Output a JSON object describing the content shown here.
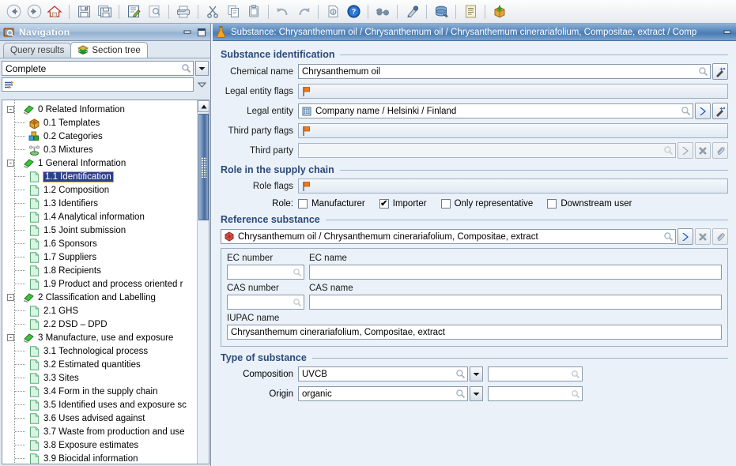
{
  "toolbar": {
    "buttons": [
      {
        "name": "back-button",
        "icon": "back-arrow-icon",
        "title": "Back"
      },
      {
        "name": "forward-button",
        "icon": "forward-arrow-icon",
        "title": "Forward"
      },
      {
        "name": "home-button",
        "icon": "home-icon",
        "title": "Home"
      },
      {
        "name": "save-button",
        "icon": "save-disk-icon",
        "title": "Save"
      },
      {
        "name": "save-all-button",
        "icon": "save-all-disk-icon",
        "title": "Save all"
      },
      {
        "name": "edit-button",
        "icon": "edit-pencil-icon",
        "title": "Edit"
      },
      {
        "name": "preview-button",
        "icon": "preview-page-icon",
        "title": "Preview"
      },
      {
        "name": "print-button",
        "icon": "printer-icon",
        "title": "Print"
      },
      {
        "name": "cut-button",
        "icon": "scissors-icon",
        "title": "Cut"
      },
      {
        "name": "copy-button",
        "icon": "copy-icon",
        "title": "Copy"
      },
      {
        "name": "paste-button",
        "icon": "paste-clipboard-icon",
        "title": "Paste"
      },
      {
        "name": "undo-button",
        "icon": "undo-arrow-icon",
        "title": "Undo"
      },
      {
        "name": "redo-button",
        "icon": "redo-arrow-icon",
        "title": "Redo"
      },
      {
        "name": "document-info-button",
        "icon": "document-info-icon",
        "title": "Document info"
      },
      {
        "name": "help-button",
        "icon": "help-question-icon",
        "title": "Help"
      },
      {
        "name": "view-button",
        "icon": "glasses-icon",
        "title": "View"
      },
      {
        "name": "annotation-button",
        "icon": "ink-pen-icon",
        "title": "Annotation"
      },
      {
        "name": "database-button",
        "icon": "database-stack-icon",
        "title": "Database"
      },
      {
        "name": "report-button",
        "icon": "report-list-icon",
        "title": "Report"
      },
      {
        "name": "package-button",
        "icon": "package-box-icon",
        "title": "Package"
      }
    ]
  },
  "navigation": {
    "title": "Navigation",
    "window_buttons": [
      {
        "name": "minimize-button",
        "icon": "minimize-icon"
      },
      {
        "name": "maximize-button",
        "icon": "maximize-icon"
      }
    ],
    "tabs": [
      {
        "label": "Query results",
        "active": false,
        "icon": null
      },
      {
        "label": "Section tree",
        "active": true,
        "icon": "layers-icon"
      }
    ],
    "filter": {
      "value": "Complete",
      "search_icon": "magnifier-icon",
      "dropdown_icon": "chevron-down-icon"
    },
    "filter2": {
      "value": "",
      "left_icon": "filter-arrows-icon",
      "dropdown_icon": "triangle-down-icon"
    },
    "tree": [
      {
        "label": "0 Related Information",
        "level": 0,
        "icon": "green-diamond-icon",
        "expander": "-",
        "selected": false
      },
      {
        "label": "0.1 Templates",
        "level": 1,
        "icon": "templates-box-icon",
        "expander": null,
        "selected": false
      },
      {
        "label": "0.2 Categories",
        "level": 1,
        "icon": "categories-icon",
        "expander": null,
        "selected": false
      },
      {
        "label": "0.3 Mixtures",
        "level": 1,
        "icon": "mixtures-icon",
        "expander": null,
        "selected": false
      },
      {
        "label": "1 General Information",
        "level": 0,
        "icon": "green-diamond-icon",
        "expander": "-",
        "selected": false
      },
      {
        "label": "1.1 Identification",
        "level": 1,
        "icon": "page-icon",
        "expander": null,
        "selected": true
      },
      {
        "label": "1.2 Composition",
        "level": 1,
        "icon": "page-icon",
        "expander": null,
        "selected": false
      },
      {
        "label": "1.3 Identifiers",
        "level": 1,
        "icon": "page-icon",
        "expander": null,
        "selected": false
      },
      {
        "label": "1.4 Analytical information",
        "level": 1,
        "icon": "page-icon",
        "expander": null,
        "selected": false
      },
      {
        "label": "1.5 Joint submission",
        "level": 1,
        "icon": "page-icon",
        "expander": null,
        "selected": false
      },
      {
        "label": "1.6 Sponsors",
        "level": 1,
        "icon": "page-icon",
        "expander": null,
        "selected": false
      },
      {
        "label": "1.7 Suppliers",
        "level": 1,
        "icon": "page-icon",
        "expander": null,
        "selected": false
      },
      {
        "label": "1.8 Recipients",
        "level": 1,
        "icon": "page-icon",
        "expander": null,
        "selected": false
      },
      {
        "label": "1.9 Product and process oriented r",
        "level": 1,
        "icon": "page-icon",
        "expander": null,
        "selected": false
      },
      {
        "label": "2 Classification and Labelling",
        "level": 0,
        "icon": "green-diamond-icon",
        "expander": "-",
        "selected": false
      },
      {
        "label": "2.1 GHS",
        "level": 1,
        "icon": "page-icon",
        "expander": null,
        "selected": false
      },
      {
        "label": "2.2 DSD – DPD",
        "level": 1,
        "icon": "page-icon",
        "expander": null,
        "selected": false
      },
      {
        "label": "3 Manufacture, use and exposure",
        "level": 0,
        "icon": "green-diamond-icon",
        "expander": "-",
        "selected": false
      },
      {
        "label": "3.1 Technological process",
        "level": 1,
        "icon": "page-icon",
        "expander": null,
        "selected": false
      },
      {
        "label": "3.2 Estimated quantities",
        "level": 1,
        "icon": "page-icon",
        "expander": null,
        "selected": false
      },
      {
        "label": "3.3 Sites",
        "level": 1,
        "icon": "page-icon",
        "expander": null,
        "selected": false
      },
      {
        "label": "3.4 Form in the supply chain",
        "level": 1,
        "icon": "page-icon",
        "expander": null,
        "selected": false
      },
      {
        "label": "3.5 Identified uses and exposure sc",
        "level": 1,
        "icon": "page-icon",
        "expander": null,
        "selected": false
      },
      {
        "label": "3.6 Uses advised against",
        "level": 1,
        "icon": "page-icon",
        "expander": null,
        "selected": false
      },
      {
        "label": "3.7 Waste from production and use",
        "level": 1,
        "icon": "page-icon",
        "expander": null,
        "selected": false
      },
      {
        "label": "3.8 Exposure estimates",
        "level": 1,
        "icon": "page-icon",
        "expander": null,
        "selected": false
      },
      {
        "label": "3.9 Biocidal information",
        "level": 1,
        "icon": "page-icon",
        "expander": null,
        "selected": false
      }
    ]
  },
  "main": {
    "title": "Substance: Chrysanthemum oil / Chrysanthemum oil / Chrysanthemum cinerariafolium, Compositae, extract / Comp",
    "title_icon": "flask-icon",
    "window_buttons": [
      {
        "name": "minimize-button",
        "icon": "minimize-icon"
      }
    ],
    "substance_identification": {
      "heading": "Substance identification",
      "chemical_name": {
        "label": "Chemical name",
        "value": "Chrysanthemum oil",
        "search_icon": "magnifier-icon",
        "action_icon": "wand-icon"
      },
      "legal_entity_flags": {
        "label": "Legal entity flags",
        "value": "",
        "flag_icon": "orange-flag-icon"
      },
      "legal_entity": {
        "label": "Legal entity",
        "value": "Company name / Helsinki / Finland",
        "entity_icon": "building-icon",
        "search_icon": "magnifier-icon",
        "go_icon": "blue-chevron-right-icon",
        "action_icon": "wand-icon"
      },
      "third_party_flags": {
        "label": "Third party flags",
        "value": "",
        "flag_icon": "orange-flag-icon"
      },
      "third_party": {
        "label": "Third party",
        "value": "",
        "search_icon": "magnifier-icon",
        "go_icon": "grey-chevron-right-icon",
        "clear_icon": "grey-x-icon",
        "attach_icon": "paperclip-icon"
      }
    },
    "role_supply_chain": {
      "heading": "Role in the supply chain",
      "role_flags": {
        "label": "Role flags",
        "value": "",
        "flag_icon": "orange-flag-icon"
      },
      "role_label": "Role:",
      "roles": [
        {
          "label": "Manufacturer",
          "checked": false
        },
        {
          "label": "Importer",
          "checked": true
        },
        {
          "label": "Only representative",
          "checked": false
        },
        {
          "label": "Downstream user",
          "checked": false
        }
      ]
    },
    "reference_substance": {
      "heading": "Reference substance",
      "selector": {
        "value": "Chrysanthemum oil / Chrysanthemum cinerariafolium, Compositae, extract",
        "entity_icon": "reference-substance-icon",
        "search_icon": "magnifier-icon",
        "go_icon": "blue-chevron-right-icon",
        "clear_icon": "grey-x-icon",
        "attach_icon": "paperclip-icon"
      },
      "ec_number": {
        "label": "EC number",
        "value": "",
        "search_icon": "magnifier-icon"
      },
      "ec_name": {
        "label": "EC name",
        "value": ""
      },
      "cas_number": {
        "label": "CAS number",
        "value": "",
        "search_icon": "magnifier-icon"
      },
      "cas_name": {
        "label": "CAS name",
        "value": ""
      },
      "iupac_name": {
        "label": "IUPAC name",
        "value": "Chrysanthemum cinerariafolium, Compositae, extract"
      }
    },
    "type_of_substance": {
      "heading": "Type of substance",
      "composition": {
        "label": "Composition",
        "value": "UVCB",
        "search_icon": "magnifier-icon",
        "dropdown_icon": "chevron-down-icon",
        "secondary_value": "",
        "secondary_search_icon": "magnifier-icon"
      },
      "origin": {
        "label": "Origin",
        "value": "organic",
        "search_icon": "magnifier-icon",
        "dropdown_icon": "chevron-down-icon",
        "secondary_value": "",
        "secondary_search_icon": "magnifier-icon"
      }
    }
  },
  "colors": {
    "title_bar_blue": "#4b7cb3",
    "nav_title_blue": "#93b2d2",
    "panel_bg": "#eaf1f9",
    "group_heading": "#2c4a78",
    "selection_blue": "#2a3f8f",
    "selection_outline": "#e2a43a",
    "flag_orange": "#f07a1e",
    "tree_icon_green": "#2eb82e",
    "go_arrow_blue": "#1a5fc0"
  }
}
